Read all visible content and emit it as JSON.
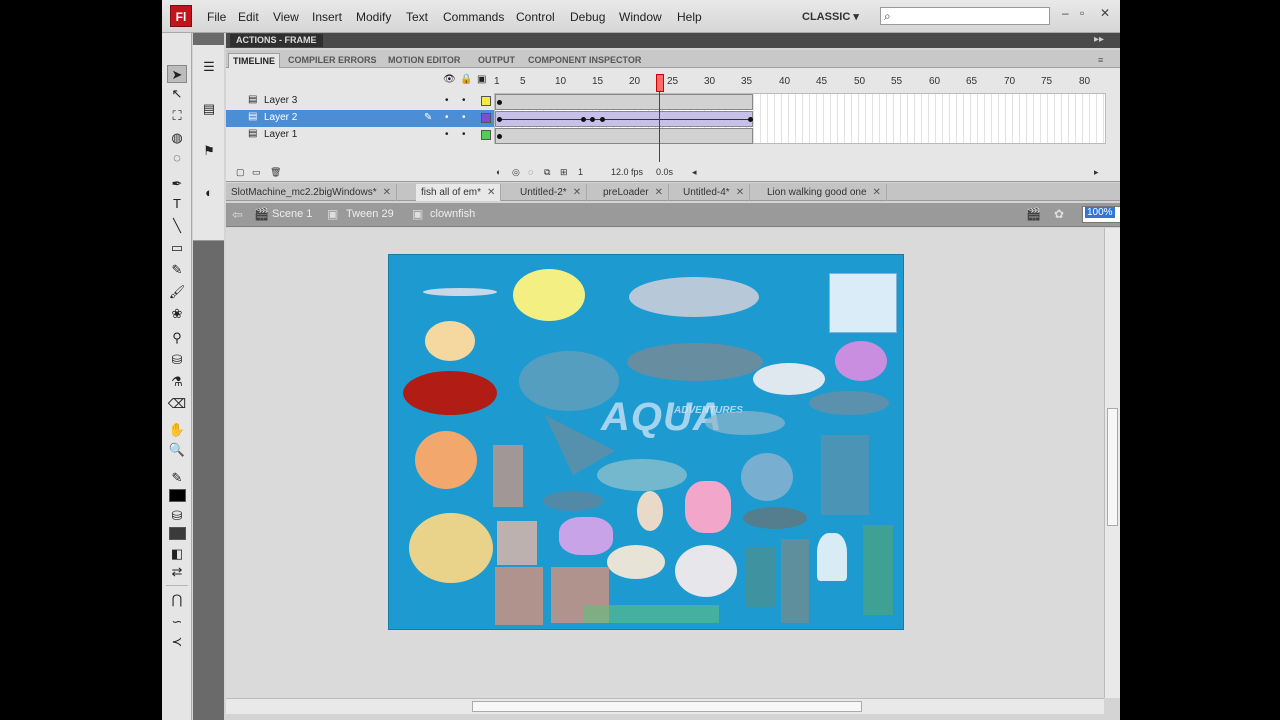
{
  "app": {
    "logo": "Fl",
    "workspace": "CLASSIC",
    "search_value": ""
  },
  "menu": [
    "File",
    "Edit",
    "View",
    "Insert",
    "Modify",
    "Text",
    "Commands",
    "Control",
    "Debug",
    "Window",
    "Help"
  ],
  "actions_panel": {
    "title": "ACTIONS - FRAME"
  },
  "panel_tabs": [
    "TIMELINE",
    "COMPILER ERRORS",
    "MOTION EDITOR",
    "OUTPUT",
    "COMPONENT INSPECTOR"
  ],
  "timeline": {
    "ruler_ticks": [
      "1",
      "5",
      "10",
      "15",
      "20",
      "25",
      "30",
      "35",
      "40",
      "45",
      "50",
      "55",
      "60",
      "65",
      "70",
      "75",
      "80"
    ],
    "layers": [
      {
        "name": "Layer 3",
        "color": "#f2e94b",
        "selected": false
      },
      {
        "name": "Layer 2",
        "color": "#7a4fd1",
        "selected": true
      },
      {
        "name": "Layer 1",
        "color": "#4fcf52",
        "selected": false
      }
    ],
    "current_frame": "1",
    "frame_rate": "12.0 fps",
    "elapsed": "0.0s"
  },
  "doc_tabs": [
    {
      "label": "SlotMachine_mc2.2bigWindows*",
      "active": false
    },
    {
      "label": "fish all of em*",
      "active": true
    },
    {
      "label": "Untitled-2*",
      "active": false
    },
    {
      "label": "preLoader",
      "active": false
    },
    {
      "label": "Untitled-4*",
      "active": false
    },
    {
      "label": "Lion walking good one",
      "active": false
    }
  ],
  "breadcrumb": [
    "Scene 1",
    "Tween 29",
    "clownfish"
  ],
  "zoom": {
    "value": "100%"
  },
  "stage": {
    "logo_text": "AQUA",
    "logo_sub": "ADVENTURES",
    "background": "#1d9bd1"
  }
}
